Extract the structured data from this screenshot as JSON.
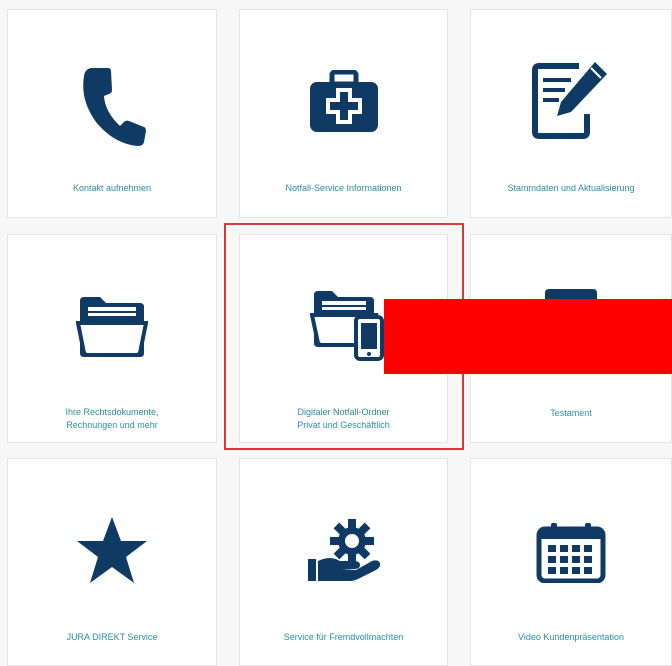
{
  "theme": {
    "icon_color": "#0f3a63",
    "label_color": "#2a8ea3",
    "highlight_color": "#d63a3a",
    "redaction_color": "#ff0000"
  },
  "tiles": [
    {
      "icon": "phone-icon",
      "label": "Kontakt aufnehmen"
    },
    {
      "icon": "first-aid-kit-icon",
      "label": "Notfall-Service Informationen"
    },
    {
      "icon": "edit-document-icon",
      "label": "Stammdaten und Aktualisierung"
    },
    {
      "icon": "folder-icon",
      "label": "Ihre Rechtsdokumente,",
      "label2": "Rechnungen und mehr"
    },
    {
      "icon": "folder-phone-icon",
      "label": "Digitaler Notfall-Ordner",
      "label2": "Privat und Geschäftlich"
    },
    {
      "icon": "testament-icon",
      "label": "Testament"
    },
    {
      "icon": "star-icon",
      "label": "JURA DIREKT Service"
    },
    {
      "icon": "hand-gear-icon",
      "label": "Service für Fremdvollmachten"
    },
    {
      "icon": "calendar-icon",
      "label": "Video Kundenpräsentation"
    }
  ]
}
